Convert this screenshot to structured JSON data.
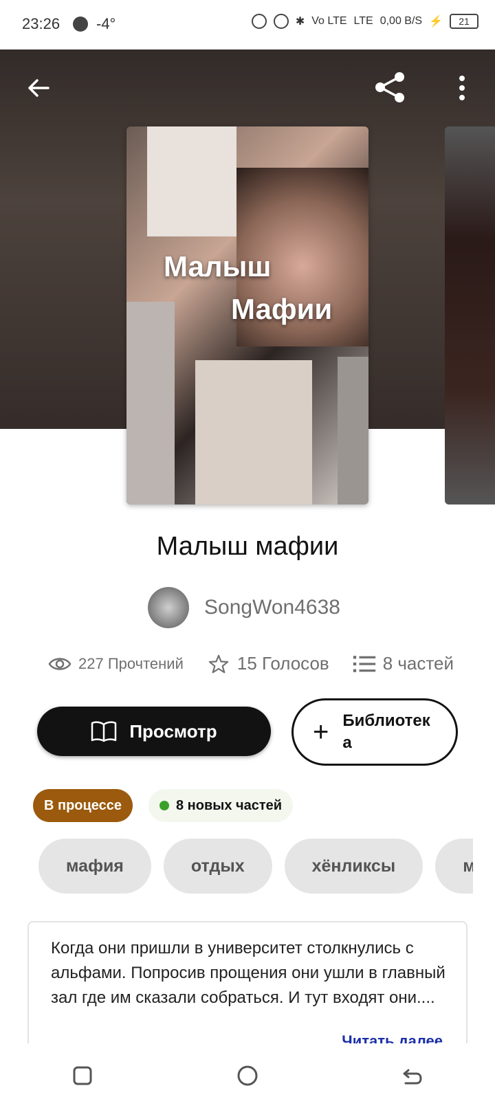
{
  "status_bar": {
    "time": "23:26",
    "temperature": "-4°",
    "net_1": "Vo LTE",
    "net_2": "LTE",
    "speed": "0,00 B/S",
    "battery": "21"
  },
  "story": {
    "cover_title_line1": "Малыш",
    "cover_title_line2": "Мафии",
    "title": "Малыш мафии",
    "author": "SongWon4638"
  },
  "stats": {
    "reads": "227 Прочтений",
    "votes": "15 Голосов",
    "parts": "8 частей"
  },
  "actions": {
    "read_label": "Просмотр",
    "library_label": "Библиотека"
  },
  "badges": {
    "status": "В процессе",
    "new_parts": "8 новых частей"
  },
  "tags": [
    "мафия",
    "отдых",
    "хёнликсы",
    "мин"
  ],
  "description": {
    "text": "Когда они пришли в университет столкнулись с альфами. Попросив прощения они ушли в главный зал где им сказали собраться. И тут входят они....",
    "more": "Читать далее"
  },
  "colors": {
    "status_badge": "#9b5a0d",
    "primary_button": "#121212",
    "new_dot": "#3aa02a"
  }
}
